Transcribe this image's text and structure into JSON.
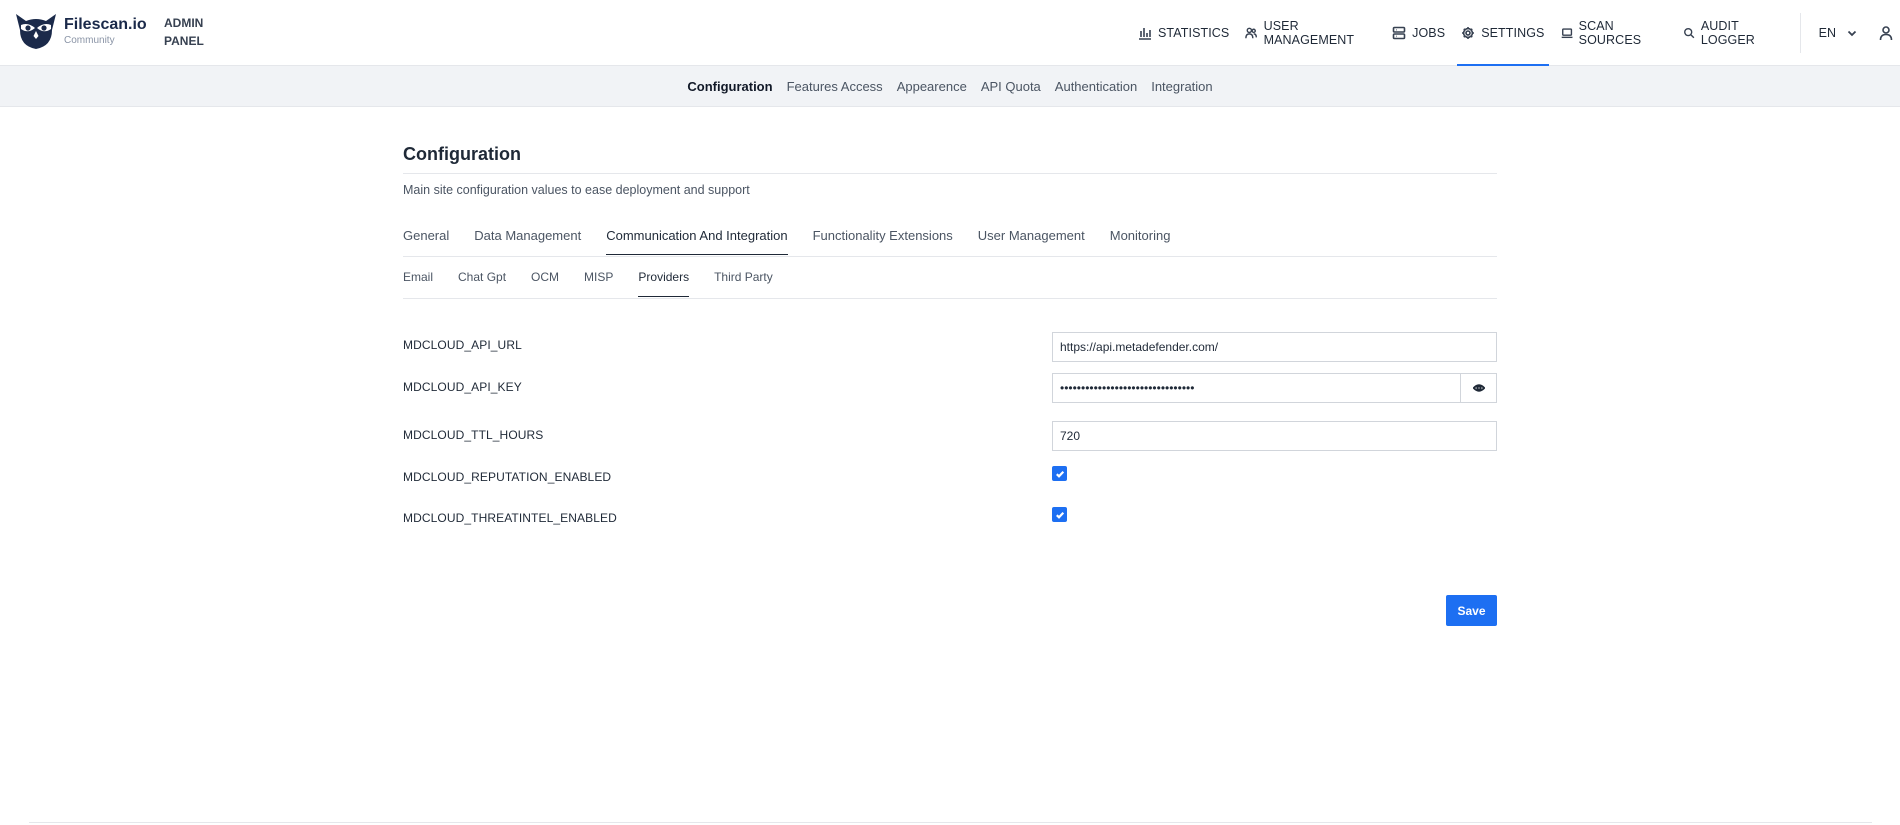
{
  "brand": {
    "name": "Filescan.io",
    "edition": "Community",
    "panel_label": "ADMIN PANEL"
  },
  "colors": {
    "accent": "#1d6ff2",
    "subnav_bg": "#f1f3f6",
    "logo_dark": "#1b2a4a"
  },
  "topnav": {
    "items": [
      {
        "label": "STATISTICS",
        "icon": "bar-chart-icon"
      },
      {
        "label": "USER MANAGEMENT",
        "icon": "users-icon"
      },
      {
        "label": "JOBS",
        "icon": "server-icon"
      },
      {
        "label": "SETTINGS",
        "icon": "gear-icon",
        "active": true
      },
      {
        "label": "SCAN SOURCES",
        "icon": "laptop-icon"
      },
      {
        "label": "AUDIT LOGGER",
        "icon": "search-icon"
      }
    ],
    "language": "EN"
  },
  "subnav": {
    "items": [
      "Configuration",
      "Features Access",
      "Appearence",
      "API Quota",
      "Authentication",
      "Integration"
    ],
    "active": "Configuration"
  },
  "page": {
    "title": "Configuration",
    "description": "Main site configuration values to ease deployment and support"
  },
  "tabs": {
    "items": [
      "General",
      "Data Management",
      "Communication And Integration",
      "Functionality Extensions",
      "User Management",
      "Monitoring"
    ],
    "active": "Communication And Integration"
  },
  "subtabs": {
    "items": [
      "Email",
      "Chat Gpt",
      "OCM",
      "MISP",
      "Providers",
      "Third Party"
    ],
    "active": "Providers"
  },
  "fields": {
    "api_url": {
      "label": "MDCLOUD_API_URL",
      "value": "https://api.metadefender.com/"
    },
    "api_key": {
      "label": "MDCLOUD_API_KEY",
      "value": "••••••••••••••••••••••••••••••••"
    },
    "ttl_hours": {
      "label": "MDCLOUD_TTL_HOURS",
      "value": "720"
    },
    "reputation_enabled": {
      "label": "MDCLOUD_REPUTATION_ENABLED",
      "checked": true
    },
    "threatintel_enabled": {
      "label": "MDCLOUD_THREATINTEL_ENABLED",
      "checked": true
    }
  },
  "actions": {
    "save_label": "Save"
  }
}
